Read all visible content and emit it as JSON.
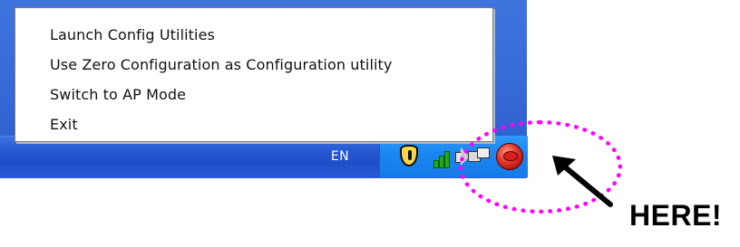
{
  "menu": {
    "items": [
      {
        "label": "Launch Config Utilities"
      },
      {
        "label": "Use Zero Configuration as Configuration utility"
      },
      {
        "label": "Switch to AP Mode"
      },
      {
        "label": "Exit"
      }
    ]
  },
  "taskbar": {
    "language": "EN",
    "tray_icons": [
      "shield-icon",
      "signal-icon",
      "speaker-icon",
      "network-icon",
      "wireless-utility-icon"
    ]
  },
  "annotation": {
    "callout": "HERE!",
    "color": "#ff00ff"
  },
  "colors": {
    "taskbar_blue": "#245edb",
    "tray_blue": "#1b87f0",
    "annotation_magenta": "#ff00ff"
  }
}
